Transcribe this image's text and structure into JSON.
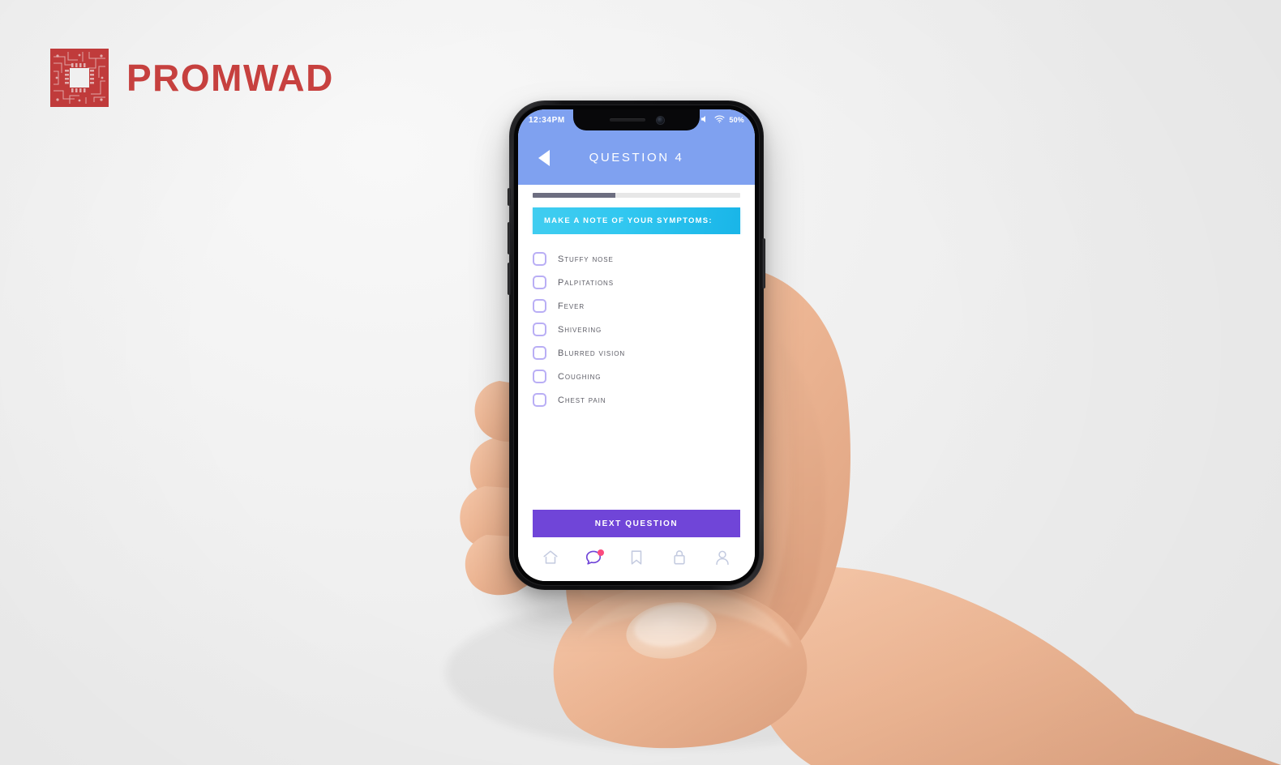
{
  "brand": {
    "name": "PROMWAD",
    "logo_icon": "circuit-board-icon",
    "color": "#c8413f"
  },
  "device": {
    "type": "smartphone-mockup",
    "frame_color": "#121214"
  },
  "statusbar": {
    "time": "12:34PM",
    "mute_icon": "speaker-mute-icon",
    "wifi_icon": "wifi-icon",
    "battery": "50%"
  },
  "header": {
    "back_icon": "back-triangle-icon",
    "title": "QUESTION 4",
    "background": "#7fa1f0"
  },
  "progress": {
    "percent": 40,
    "fill_color": "#6d6e80",
    "track_color": "#e7e7e7"
  },
  "banner": {
    "text": "MAKE A NOTE OF YOUR SYMPTOMS:",
    "color": "#31c7f0"
  },
  "checklist": {
    "items": [
      {
        "label": "Stuffy nose",
        "checked": false
      },
      {
        "label": "Palpitations",
        "checked": false
      },
      {
        "label": "Fever",
        "checked": false
      },
      {
        "label": "Shivering",
        "checked": false
      },
      {
        "label": "Blurred vision",
        "checked": false
      },
      {
        "label": "Coughing",
        "checked": false
      },
      {
        "label": "Chest pain",
        "checked": false
      }
    ],
    "checkbox_color": "#b9aef5"
  },
  "cta": {
    "label": "NEXT QUESTION",
    "color": "#7045d8"
  },
  "bottom_nav": {
    "items": [
      {
        "icon": "home-icon",
        "active": false,
        "badge": false
      },
      {
        "icon": "chat-bubble-icon",
        "active": true,
        "badge": true
      },
      {
        "icon": "bookmark-icon",
        "active": false,
        "badge": false
      },
      {
        "icon": "lock-icon",
        "active": false,
        "badge": false
      },
      {
        "icon": "person-icon",
        "active": false,
        "badge": false
      }
    ],
    "inactive_color": "#c4cbe0",
    "active_color": "#7045d8",
    "badge_color": "#fb4b7e"
  }
}
